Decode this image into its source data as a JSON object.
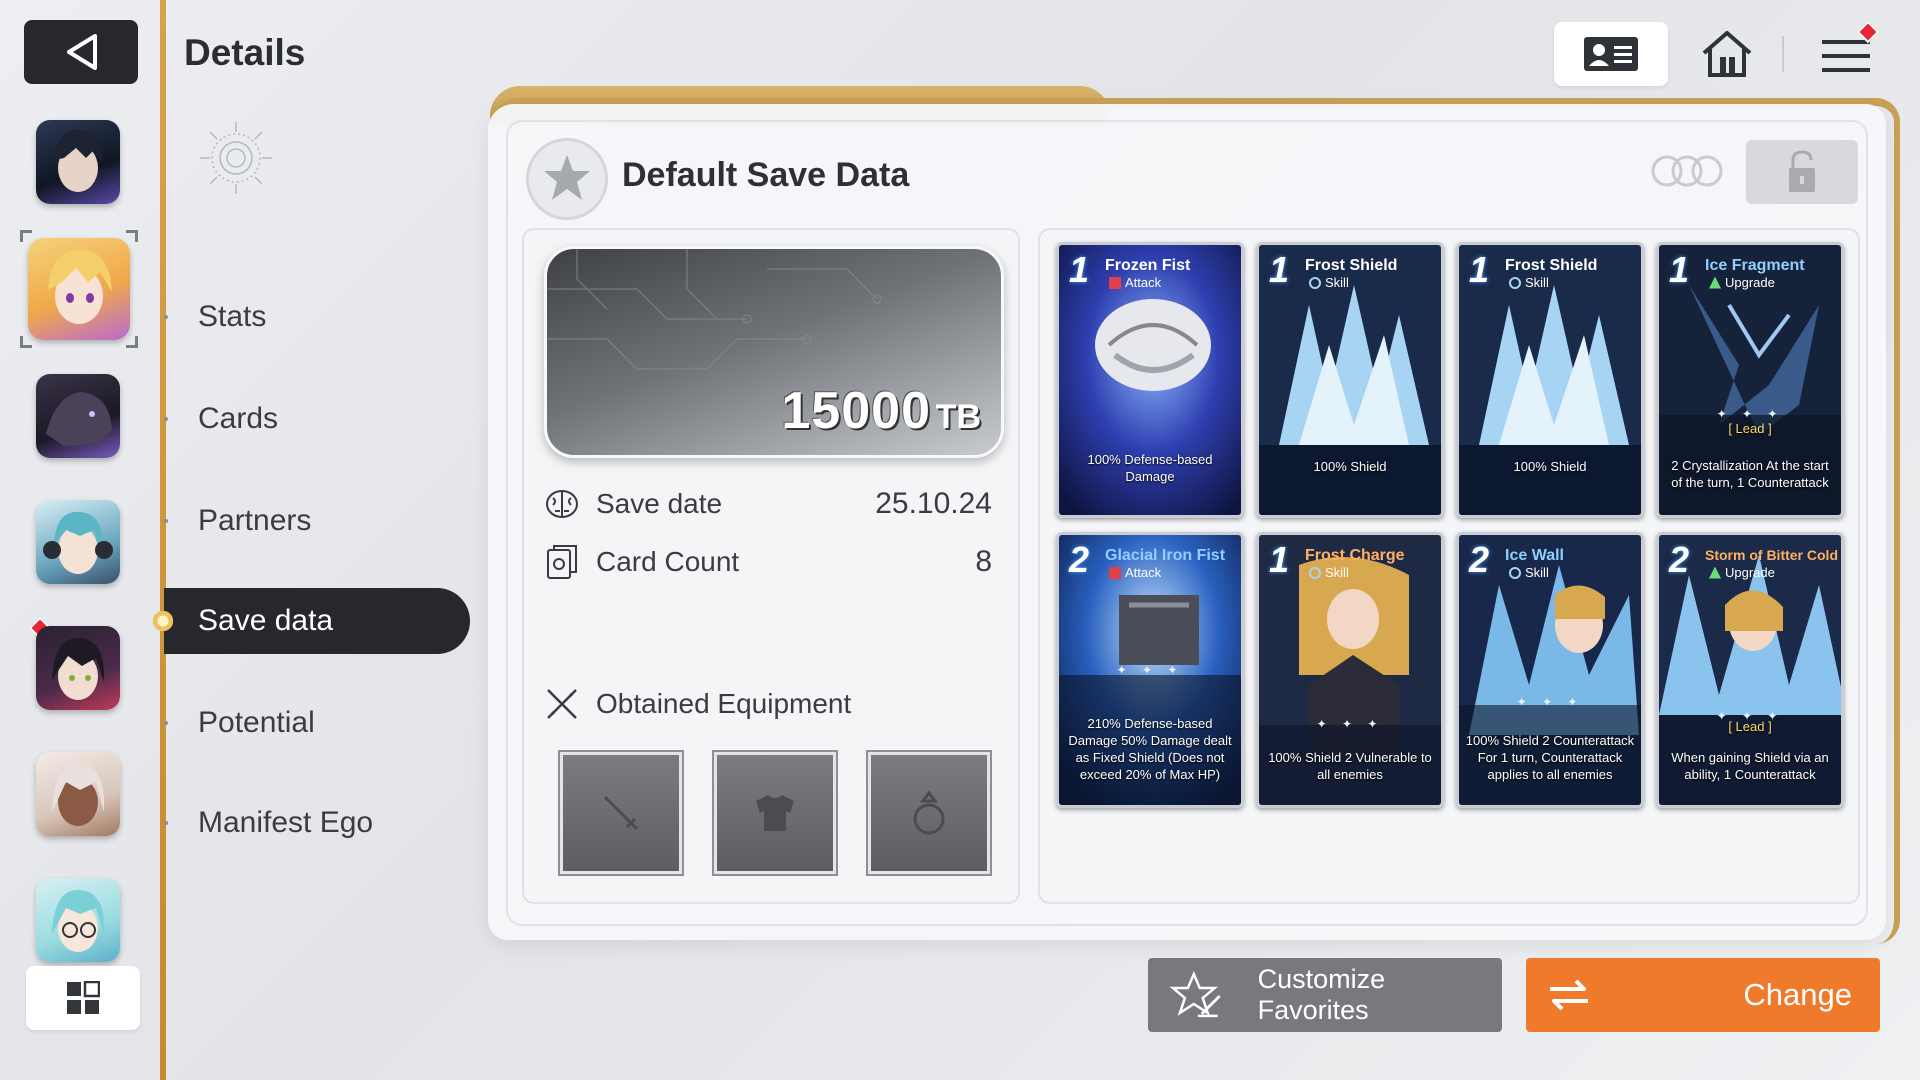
{
  "header": {
    "title": "Details"
  },
  "nav": {
    "items": [
      {
        "label": "Stats"
      },
      {
        "label": "Cards"
      },
      {
        "label": "Partners"
      },
      {
        "label": "Save data"
      },
      {
        "label": "Potential"
      },
      {
        "label": "Manifest Ego"
      }
    ],
    "active_index": 3
  },
  "save": {
    "title": "Default Save Data",
    "tb_value": "15000",
    "tb_unit": "TB",
    "save_date_label": "Save date",
    "save_date_value": "25.10.24",
    "card_count_label": "Card Count",
    "card_count_value": "8",
    "equipment_label": "Obtained Equipment"
  },
  "cards": [
    {
      "cost": "1",
      "name": "Frozen Fist",
      "type": "Attack",
      "desc": "100% Defense-based Damage"
    },
    {
      "cost": "1",
      "name": "Frost Shield",
      "type": "Skill",
      "desc": "100% Shield"
    },
    {
      "cost": "1",
      "name": "Frost Shield",
      "type": "Skill",
      "desc": "100% Shield"
    },
    {
      "cost": "1",
      "name": "Ice Fragment",
      "type": "Upgrade",
      "lead": "[ Lead ]",
      "desc": "2 Crystallization At the start of the turn, 1 Counterattack"
    },
    {
      "cost": "2",
      "name": "Glacial Iron Fist",
      "type": "Attack",
      "desc": "210% Defense-based Damage 50% Damage dealt as Fixed Shield (Does not exceed 20% of Max HP)"
    },
    {
      "cost": "1",
      "name": "Frost Charge",
      "type": "Skill",
      "desc": "100% Shield 2 Vulnerable to all enemies"
    },
    {
      "cost": "2",
      "name": "Ice Wall",
      "type": "Skill",
      "desc": "100% Shield 2 Counterattack For 1 turn, Counterattack applies to all enemies"
    },
    {
      "cost": "2",
      "name": "Storm of Bitter Cold",
      "type": "Upgrade",
      "lead": "[ Lead ]",
      "desc": "When gaining Shield via an ability, 1 Counterattack"
    }
  ],
  "buttons": {
    "favorites": "Customize Favorites",
    "change": "Change"
  },
  "colors": {
    "accent_orange": "#f07a2c",
    "gold_frame": "#c9a055",
    "dark_button": "#26282b",
    "notification_red": "#e8243a"
  }
}
